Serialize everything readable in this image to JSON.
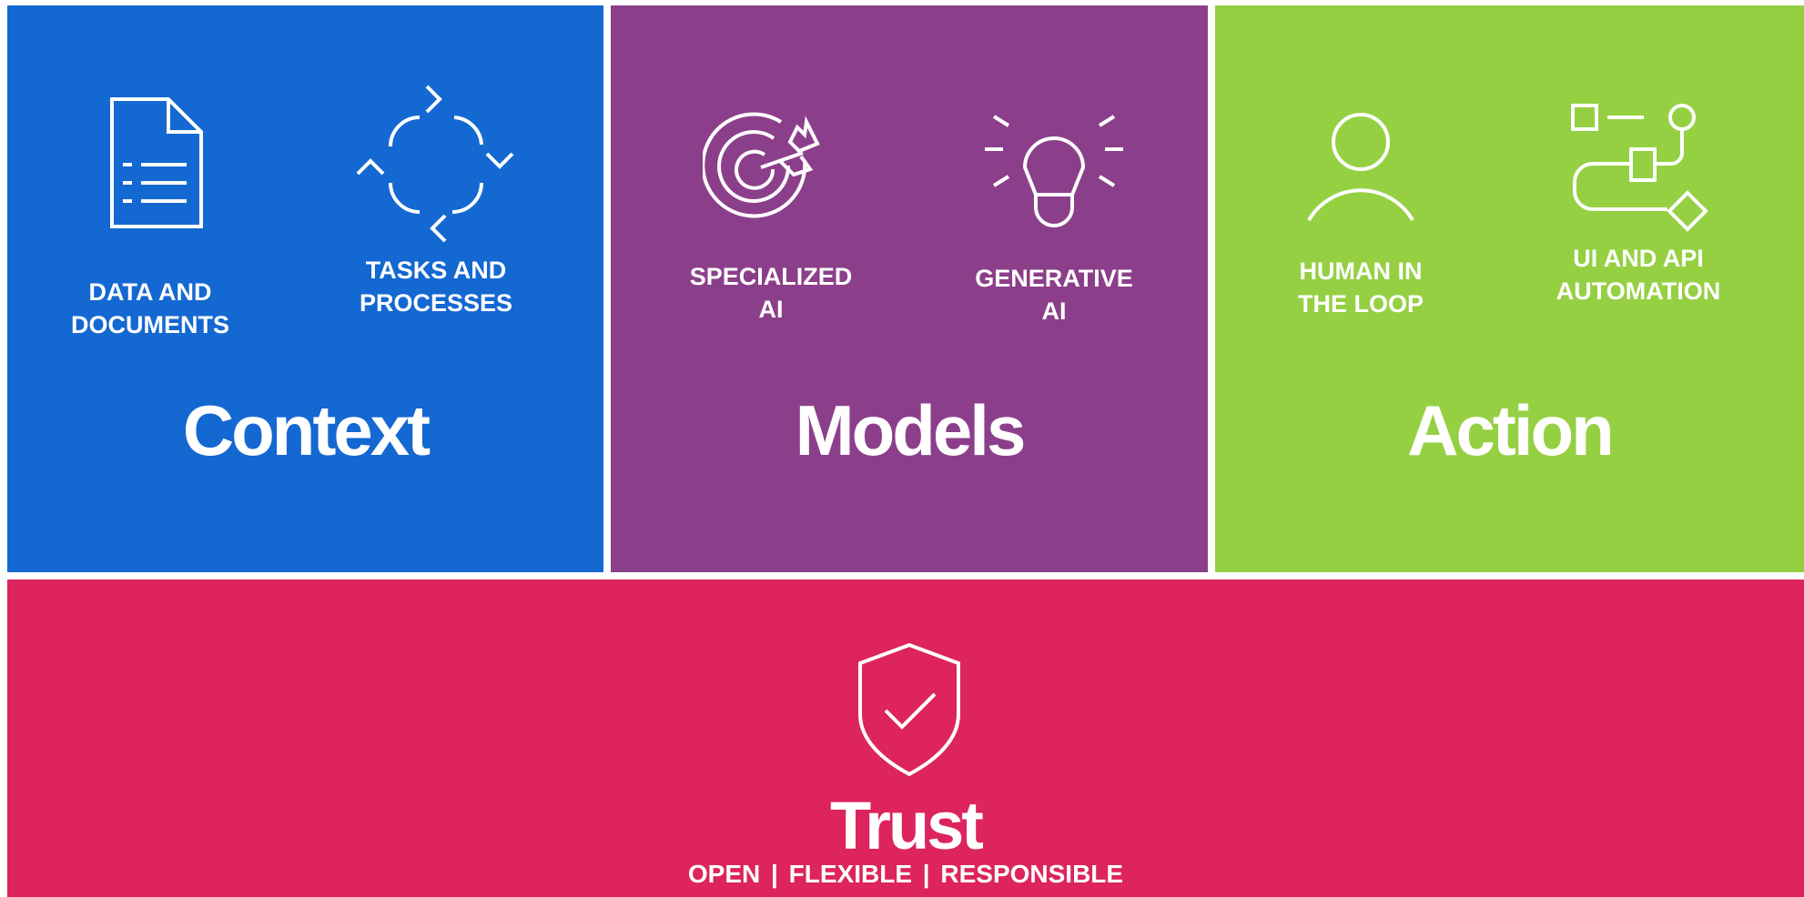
{
  "colors": {
    "context": "#1468D1",
    "models": "#8B3F8A",
    "action": "#95D043",
    "trust": "#DD245D",
    "foreground": "#FFFFFF"
  },
  "panels": {
    "context": {
      "title": "Context",
      "items": [
        {
          "icon": "document-icon",
          "label": "DATA AND\nDOCUMENTS"
        },
        {
          "icon": "cycle-arrows-icon",
          "label": "TASKS AND\nPROCESSES"
        }
      ]
    },
    "models": {
      "title": "Models",
      "items": [
        {
          "icon": "target-icon",
          "label": "SPECIALIZED\nAI"
        },
        {
          "icon": "lightbulb-icon",
          "label": "GENERATIVE\nAI"
        }
      ]
    },
    "action": {
      "title": "Action",
      "items": [
        {
          "icon": "person-icon",
          "label": "HUMAN IN\nTHE LOOP"
        },
        {
          "icon": "workflow-icon",
          "label": "UI AND API\nAUTOMATION"
        }
      ]
    },
    "trust": {
      "icon": "shield-check-icon",
      "title": "Trust",
      "subtitle": "OPEN  |  FLEXIBLE  |  RESPONSIBLE"
    }
  }
}
